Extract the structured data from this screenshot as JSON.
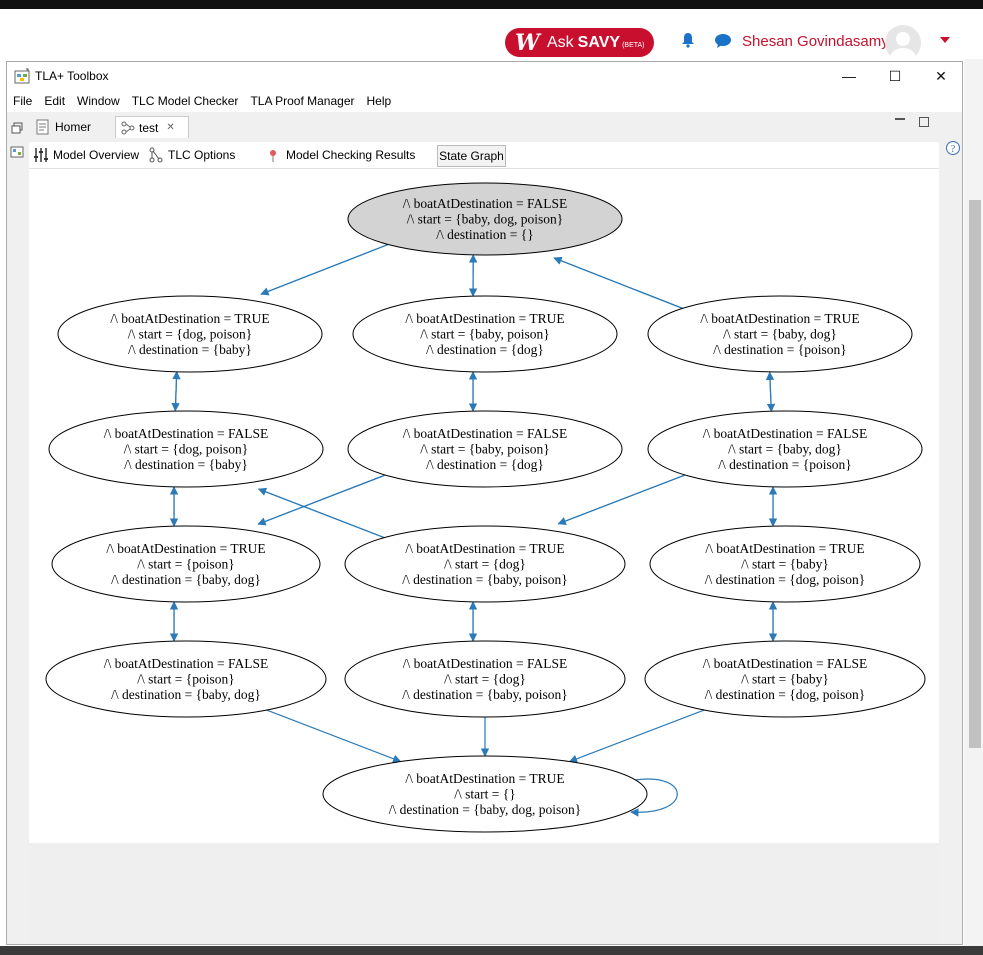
{
  "web_header": {
    "ask_logo": "W",
    "ask_label": "Ask",
    "savy_label": "SAVY",
    "beta_label": "(BETA)",
    "user_name": "Shesan Govindasamy"
  },
  "window": {
    "title": "TLA+ Toolbox",
    "controls": {
      "minimize": "—",
      "maximize": "☐",
      "close": "✕"
    }
  },
  "menu": [
    {
      "label": "File",
      "mnemonic": "F"
    },
    {
      "label": "Edit",
      "mnemonic": "E"
    },
    {
      "label": "Window",
      "mnemonic": "W"
    },
    {
      "label": "TLC Model Checker",
      "mnemonic": "T"
    },
    {
      "label": "TLA Proof Manager",
      "mnemonic": "T"
    },
    {
      "label": "Help",
      "mnemonic": "H"
    }
  ],
  "editor_tabs": [
    {
      "label": "Homer",
      "active": false
    },
    {
      "label": "test",
      "active": true,
      "close": "✕"
    }
  ],
  "page_tabs": [
    {
      "label": "Model Overview"
    },
    {
      "label": "TLC Options"
    },
    {
      "label": "Model Checking Results"
    },
    {
      "label": "State Graph",
      "selected": true
    }
  ],
  "state_graph": {
    "edge_color": "#2a7ab8",
    "initial_fill": "#d3d3d3",
    "nodes": [
      {
        "id": "n0",
        "lines": [
          "/\\ boatAtDestination = FALSE",
          "/\\ start = {baby, dog, poison}",
          "/\\ destination = {}"
        ],
        "initial": true
      },
      {
        "id": "n1",
        "lines": [
          "/\\ boatAtDestination = TRUE",
          "/\\ start = {dog, poison}",
          "/\\ destination = {baby}"
        ]
      },
      {
        "id": "n2",
        "lines": [
          "/\\ boatAtDestination = TRUE",
          "/\\ start = {baby, poison}",
          "/\\ destination = {dog}"
        ]
      },
      {
        "id": "n3",
        "lines": [
          "/\\ boatAtDestination = TRUE",
          "/\\ start = {baby, dog}",
          "/\\ destination = {poison}"
        ]
      },
      {
        "id": "n4",
        "lines": [
          "/\\ boatAtDestination = FALSE",
          "/\\ start = {dog, poison}",
          "/\\ destination = {baby}"
        ]
      },
      {
        "id": "n5",
        "lines": [
          "/\\ boatAtDestination = FALSE",
          "/\\ start = {baby, poison}",
          "/\\ destination = {dog}"
        ]
      },
      {
        "id": "n6",
        "lines": [
          "/\\ boatAtDestination = FALSE",
          "/\\ start = {baby, dog}",
          "/\\ destination = {poison}"
        ]
      },
      {
        "id": "n7",
        "lines": [
          "/\\ boatAtDestination = TRUE",
          "/\\ start = {poison}",
          "/\\ destination = {baby, dog}"
        ]
      },
      {
        "id": "n8",
        "lines": [
          "/\\ boatAtDestination = TRUE",
          "/\\ start = {dog}",
          "/\\ destination = {baby, poison}"
        ]
      },
      {
        "id": "n9",
        "lines": [
          "/\\ boatAtDestination = TRUE",
          "/\\ start = {baby}",
          "/\\ destination = {dog, poison}"
        ]
      },
      {
        "id": "n10",
        "lines": [
          "/\\ boatAtDestination = FALSE",
          "/\\ start = {poison}",
          "/\\ destination = {baby, dog}"
        ]
      },
      {
        "id": "n11",
        "lines": [
          "/\\ boatAtDestination = FALSE",
          "/\\ start = {dog}",
          "/\\ destination = {baby, poison}"
        ]
      },
      {
        "id": "n12",
        "lines": [
          "/\\ boatAtDestination = FALSE",
          "/\\ start = {baby}",
          "/\\ destination = {dog, poison}"
        ]
      },
      {
        "id": "n13",
        "lines": [
          "/\\ boatAtDestination = TRUE",
          "/\\ start = {}",
          "/\\ destination = {baby, dog, poison}"
        ]
      }
    ],
    "edges": [
      [
        "n0",
        "n1"
      ],
      [
        "n1",
        "n0"
      ],
      [
        "n0",
        "n2"
      ],
      [
        "n2",
        "n0"
      ],
      [
        "n0",
        "n3"
      ],
      [
        "n3",
        "n0"
      ],
      [
        "n1",
        "n4"
      ],
      [
        "n4",
        "n1"
      ],
      [
        "n2",
        "n5"
      ],
      [
        "n5",
        "n2"
      ],
      [
        "n3",
        "n6"
      ],
      [
        "n6",
        "n3"
      ],
      [
        "n4",
        "n7"
      ],
      [
        "n7",
        "n4"
      ],
      [
        "n4",
        "n8"
      ],
      [
        "n8",
        "n4"
      ],
      [
        "n5",
        "n7"
      ],
      [
        "n7",
        "n5"
      ],
      [
        "n6",
        "n8"
      ],
      [
        "n8",
        "n6"
      ],
      [
        "n6",
        "n9"
      ],
      [
        "n9",
        "n6"
      ],
      [
        "n7",
        "n10"
      ],
      [
        "n10",
        "n7"
      ],
      [
        "n8",
        "n11"
      ],
      [
        "n11",
        "n8"
      ],
      [
        "n9",
        "n12"
      ],
      [
        "n12",
        "n9"
      ],
      [
        "n10",
        "n13"
      ],
      [
        "n11",
        "n13"
      ],
      [
        "n12",
        "n13"
      ],
      [
        "n13",
        "n13"
      ]
    ]
  }
}
